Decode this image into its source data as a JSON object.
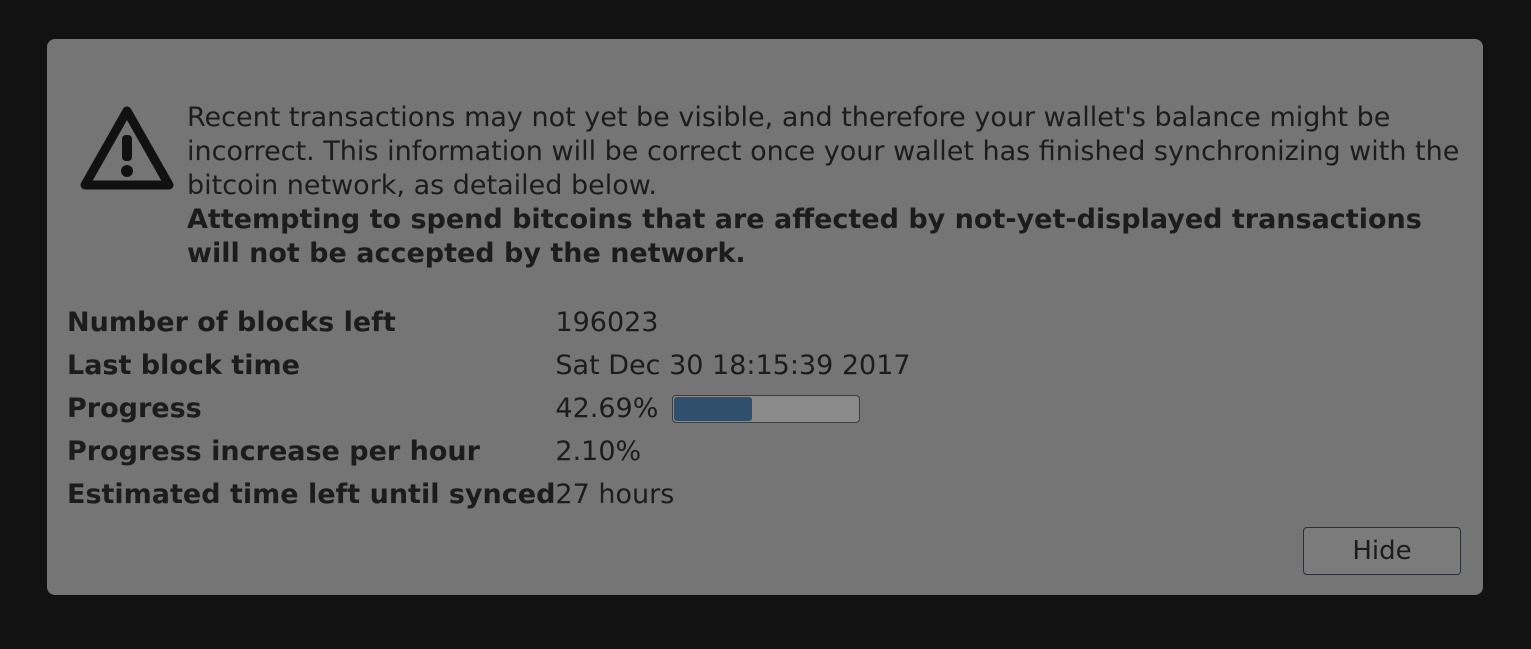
{
  "warning": {
    "icon": "warning-triangle-icon",
    "line1": "Recent transactions may not yet be visible, and therefore your wallet's balance might be incorrect. This information will be correct once your wallet has finished synchronizing with the bitcoin network, as detailed below.",
    "line2": "Attempting to spend bitcoins that are affected by not-yet-displayed transactions will not be accepted by the network."
  },
  "info": {
    "blocks_left_label": "Number of blocks left",
    "blocks_left_value": "196023",
    "last_block_time_label": "Last block time",
    "last_block_time_value": "Sat Dec 30 18:15:39 2017",
    "progress_label": "Progress",
    "progress_value": "42.69%",
    "progress_fraction": 0.4269,
    "progress_increase_label": "Progress increase per hour",
    "progress_increase_value": "2.10%",
    "time_left_label": "Estimated time left until synced",
    "time_left_value": "27 hours"
  },
  "buttons": {
    "hide_label": "Hide"
  },
  "colors": {
    "overlay_bg": "#757575",
    "progress_fill": "#2f4f6c",
    "page_bg": "#121212"
  }
}
